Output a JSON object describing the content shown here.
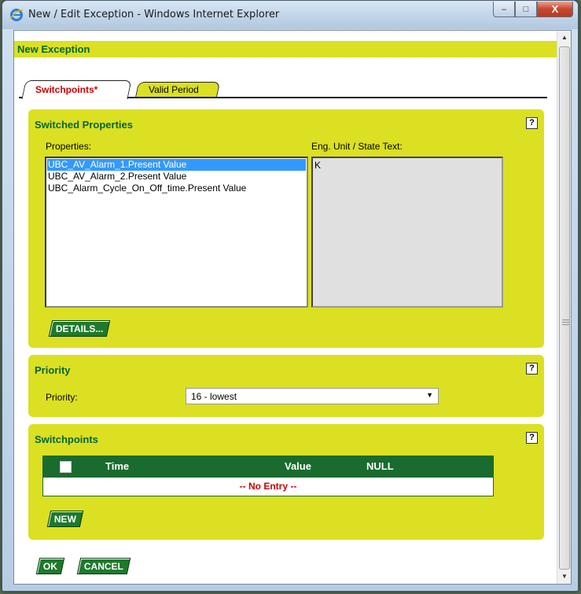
{
  "window": {
    "title": "New / Edit Exception - Windows Internet Explorer",
    "minimize": "–",
    "maximize": "□",
    "close": "X"
  },
  "header": {
    "title": "New Exception"
  },
  "tabs": [
    {
      "label": "Switchpoints*",
      "active": true
    },
    {
      "label": "Valid Period",
      "active": false
    }
  ],
  "switched_properties": {
    "title": "Switched Properties",
    "help": "?",
    "properties_label": "Properties:",
    "eng_unit_label": "Eng. Unit / State Text:",
    "properties": [
      "UBC_AV_Alarm_1.Present Value",
      "UBC_AV_Alarm_2.Present Value",
      "UBC_Alarm_Cycle_On_Off_time.Present Value"
    ],
    "selected_index": 0,
    "eng_unit_value": "K",
    "details_button": "DETAILS..."
  },
  "priority": {
    "title": "Priority",
    "help": "?",
    "label": "Priority:",
    "selected": "16 - lowest"
  },
  "switchpoints": {
    "title": "Switchpoints",
    "help": "?",
    "columns": [
      "Time",
      "Value",
      "NULL"
    ],
    "empty_text": "-- No Entry --",
    "new_button": "NEW"
  },
  "footer": {
    "ok_button": "OK",
    "cancel_button": "CANCEL"
  },
  "colors": {
    "accent": "#dbe022",
    "heading": "#006633",
    "button": "#1e7a2c",
    "alert": "#cc0000"
  }
}
